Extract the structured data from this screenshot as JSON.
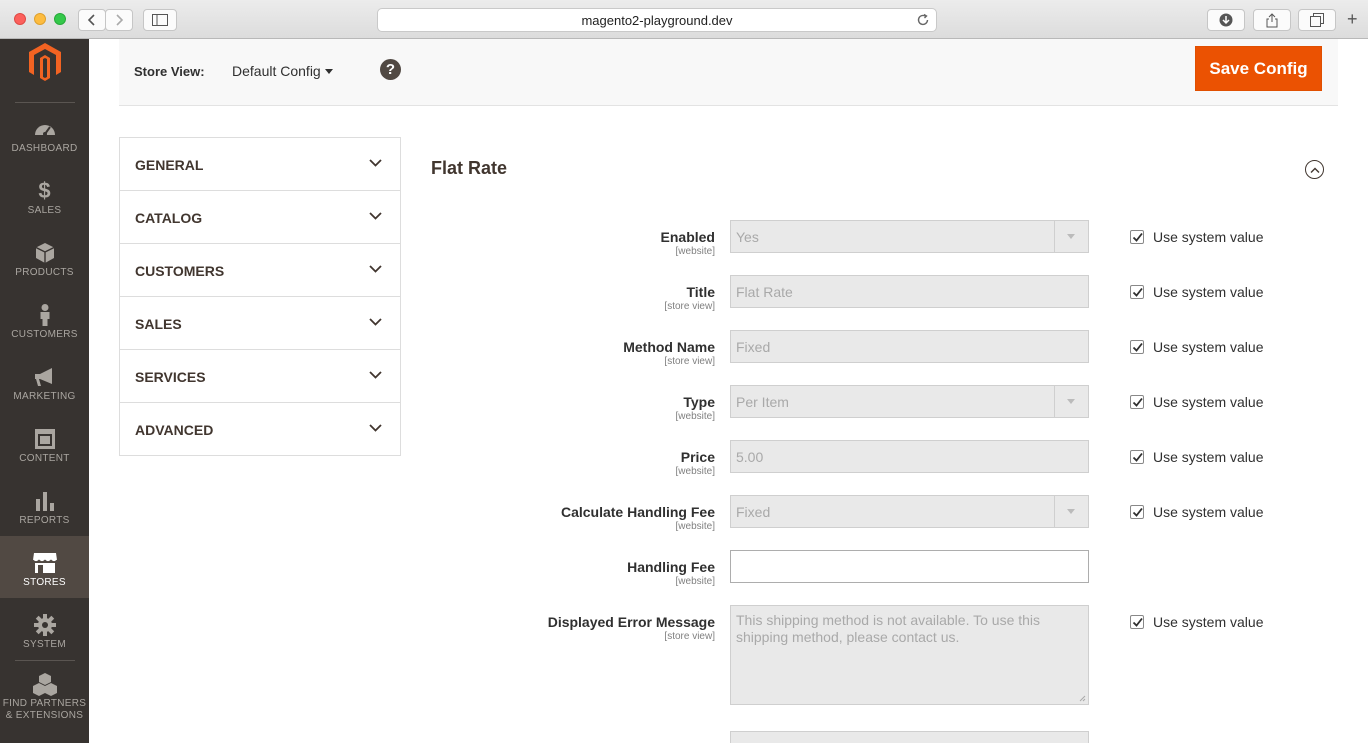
{
  "browser": {
    "url": "magento2-playground.dev"
  },
  "sidebar": {
    "items": [
      {
        "label": "DASHBOARD",
        "icon": "dashboard-icon"
      },
      {
        "label": "SALES",
        "icon": "dollar-icon"
      },
      {
        "label": "PRODUCTS",
        "icon": "cube-icon"
      },
      {
        "label": "CUSTOMERS",
        "icon": "person-icon"
      },
      {
        "label": "MARKETING",
        "icon": "megaphone-icon"
      },
      {
        "label": "CONTENT",
        "icon": "layout-icon"
      },
      {
        "label": "REPORTS",
        "icon": "bar-chart-icon"
      },
      {
        "label": "STORES",
        "icon": "storefront-icon",
        "active": true
      },
      {
        "label": "SYSTEM",
        "icon": "gear-icon"
      },
      {
        "label": "FIND PARTNERS & EXTENSIONS",
        "label_line1": "FIND PARTNERS",
        "label_line2": "& EXTENSIONS",
        "icon": "boxes-icon"
      }
    ]
  },
  "header": {
    "store_view_label": "Store View:",
    "store_view_value": "Default Config",
    "help": "?",
    "save_label": "Save Config"
  },
  "tabs": [
    {
      "label": "GENERAL"
    },
    {
      "label": "CATALOG"
    },
    {
      "label": "CUSTOMERS"
    },
    {
      "label": "SALES"
    },
    {
      "label": "SERVICES"
    },
    {
      "label": "ADVANCED"
    }
  ],
  "section": {
    "title": "Flat Rate",
    "system_value_label": "Use system value",
    "fields": [
      {
        "label": "Enabled",
        "scope": "[website]",
        "type": "select",
        "value": "Yes",
        "use_system": true
      },
      {
        "label": "Title",
        "scope": "[store view]",
        "type": "text",
        "value": "Flat Rate",
        "use_system": true
      },
      {
        "label": "Method Name",
        "scope": "[store view]",
        "type": "text",
        "value": "Fixed",
        "use_system": true
      },
      {
        "label": "Type",
        "scope": "[website]",
        "type": "select",
        "value": "Per Item",
        "use_system": true
      },
      {
        "label": "Price",
        "scope": "[website]",
        "type": "text",
        "value": "5.00",
        "use_system": true
      },
      {
        "label": "Calculate Handling Fee",
        "scope": "[website]",
        "type": "select",
        "value": "Fixed",
        "use_system": true
      },
      {
        "label": "Handling Fee",
        "scope": "[website]",
        "type": "text",
        "value": "",
        "use_system": false
      },
      {
        "label": "Displayed Error Message",
        "scope": "[store view]",
        "type": "textarea",
        "value": "This shipping method is not available. To use this shipping method, please contact us.",
        "use_system": true
      }
    ]
  },
  "colors": {
    "sidebar_bg": "#373330",
    "sidebar_active": "#514943",
    "accent": "#eb5202",
    "logo": "#f26322"
  }
}
